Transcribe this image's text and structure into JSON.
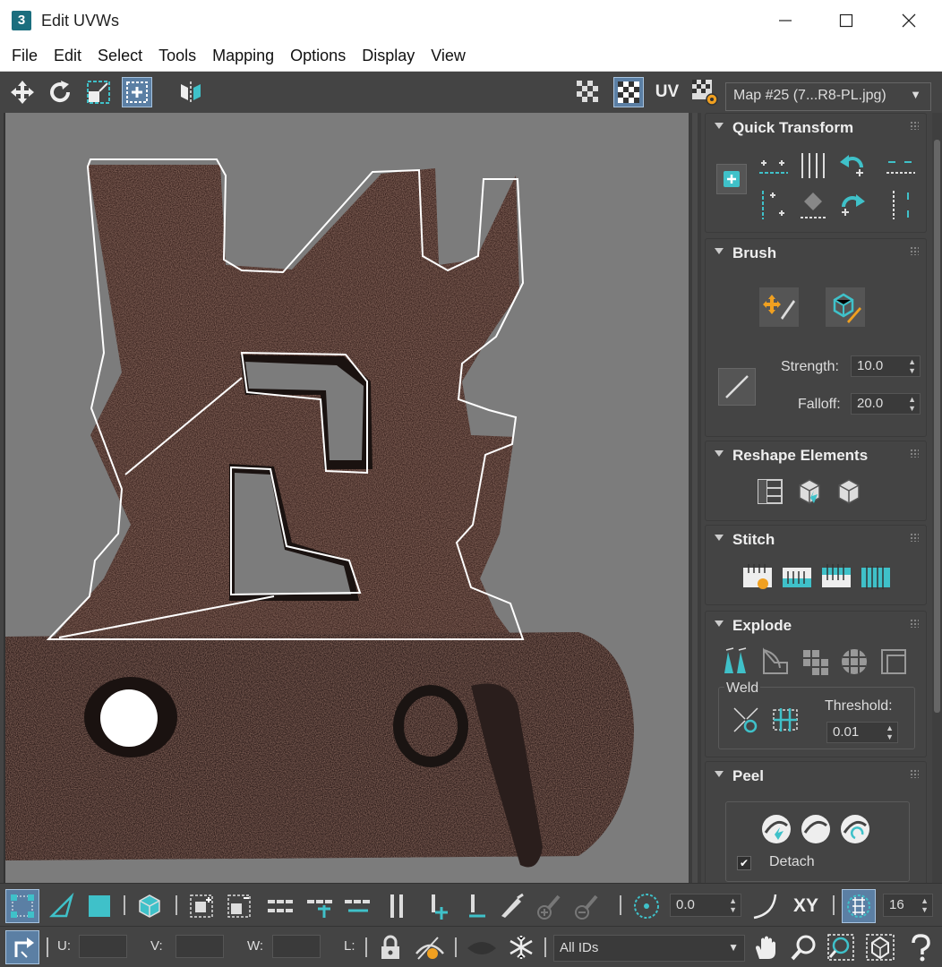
{
  "window": {
    "title": "Edit UVWs",
    "app_icon_text": "3"
  },
  "menu": [
    "File",
    "Edit",
    "Select",
    "Tools",
    "Mapping",
    "Options",
    "Display",
    "View"
  ],
  "toolbar": {
    "uv_label": "UV",
    "map_select": "Map #25 (7...R8-PL.jpg)"
  },
  "rollouts": {
    "quick_transform": {
      "title": "Quick Transform"
    },
    "brush": {
      "title": "Brush",
      "strength_label": "Strength:",
      "strength_value": "10.0",
      "falloff_label": "Falloff:",
      "falloff_value": "20.0"
    },
    "reshape": {
      "title": "Reshape Elements"
    },
    "stitch": {
      "title": "Stitch"
    },
    "explode": {
      "title": "Explode",
      "weld_label": "Weld",
      "threshold_label": "Threshold:",
      "threshold_value": "0.01"
    },
    "peel": {
      "title": "Peel",
      "detach_label": "Detach"
    }
  },
  "bottom": {
    "rotation_value": "0.0",
    "xy_label": "XY",
    "grid_value": "16",
    "u_label": "U:",
    "v_label": "V:",
    "w_label": "W:",
    "l_label": "L:",
    "ids_select": "All IDs"
  },
  "colors": {
    "accent": "#3fc1c9",
    "active_bg": "#5b7fa4",
    "panel_bg": "#444444",
    "viewport_bg": "#7c7c7c"
  }
}
